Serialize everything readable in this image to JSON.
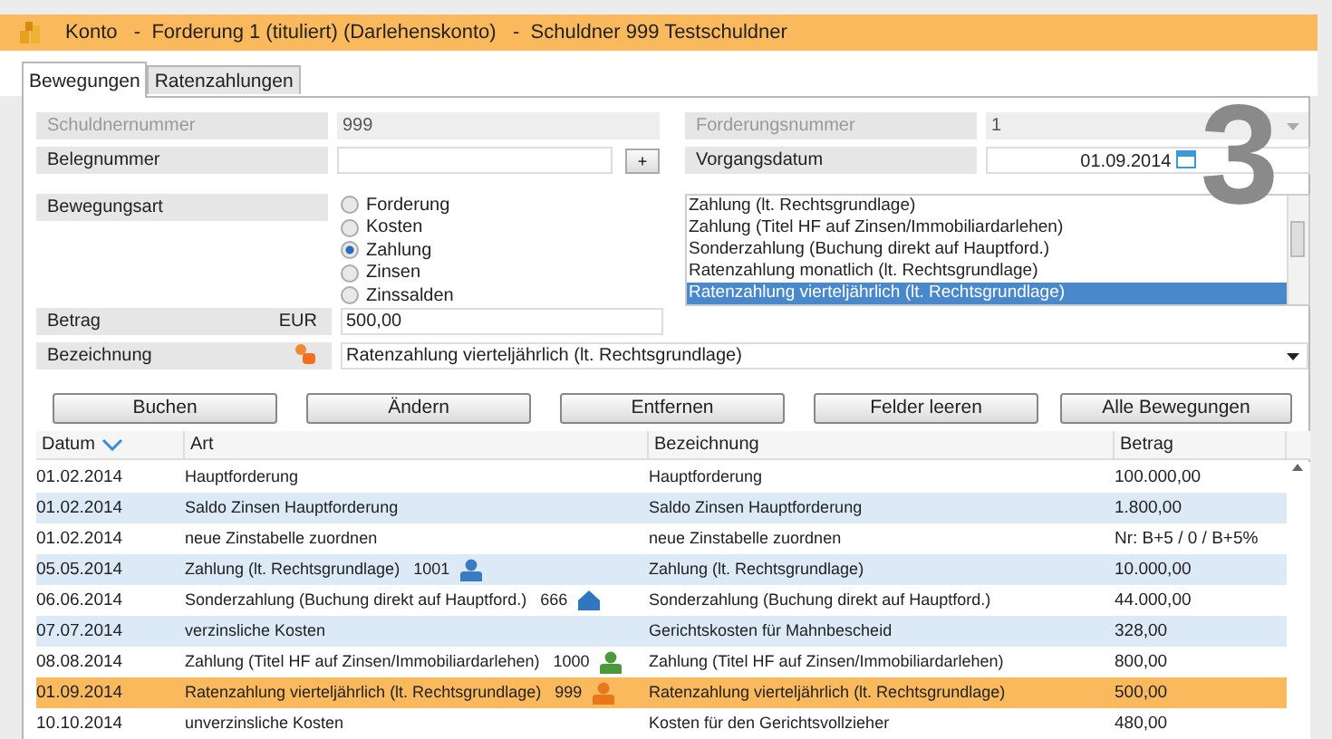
{
  "window": {
    "title": "Konto   -  Forderung 1 (tituliert) (Darlehenskonto)   -  Schuldner 999 Testschuldner"
  },
  "tabs": [
    {
      "label": "Bewegungen",
      "selected": true
    },
    {
      "label": "Ratenzahlungen",
      "selected": false
    }
  ],
  "form": {
    "schuldnernummer": {
      "label": "Schuldnernummer",
      "value": "999",
      "disabled": true
    },
    "forderungsnummer": {
      "label": "Forderungsnummer",
      "value": "1",
      "disabled": true
    },
    "belegnummer": {
      "label": "Belegnummer",
      "button": "+"
    },
    "vorgangsdatum": {
      "label": "Vorgangsdatum",
      "value": "01.09.2014"
    },
    "bewegungsart": {
      "label": "Bewegungsart",
      "options": [
        {
          "label": "Forderung",
          "selected": false
        },
        {
          "label": "Kosten",
          "selected": false
        },
        {
          "label": "Zahlung",
          "selected": true
        },
        {
          "label": "Zinsen",
          "selected": false
        },
        {
          "label": "Zinssalden",
          "selected": false
        }
      ]
    },
    "art_list": [
      {
        "label": "Zahlung (lt. Rechtsgrundlage)",
        "selected": false
      },
      {
        "label": "Zahlung (Titel HF auf Zinsen/Immobiliardarlehen)",
        "selected": false
      },
      {
        "label": "Sonderzahlung (Buchung direkt auf Hauptford.)",
        "selected": false
      },
      {
        "label": "Ratenzahlung monatlich (lt. Rechtsgrundlage)",
        "selected": false
      },
      {
        "label": "Ratenzahlung vierteljährlich (lt. Rechtsgrundlage)",
        "selected": true
      }
    ],
    "betrag": {
      "label": "Betrag",
      "currency": "EUR",
      "value": "500,00"
    },
    "bezeichnung": {
      "label": "Bezeichnung",
      "value": "Ratenzahlung vierteljährlich (lt. Rechtsgrundlage)"
    }
  },
  "step_marker": "3",
  "buttons": [
    "Buchen",
    "Ändern",
    "Entfernen",
    "Felder leeren",
    "Alle Bewegungen"
  ],
  "table": {
    "columns": [
      "Datum",
      "Art",
      "Bezeichnung",
      "Betrag"
    ],
    "rows": [
      {
        "datum": "01.02.2014",
        "art": "Hauptforderung",
        "bezeichnung": "Hauptforderung",
        "betrag": "100.000,00",
        "selected": false
      },
      {
        "datum": "01.02.2014",
        "art": "Saldo Zinsen Hauptforderung",
        "bezeichnung": "Saldo Zinsen Hauptforderung",
        "betrag": "1.800,00",
        "selected": false
      },
      {
        "datum": "01.02.2014",
        "art": "neue Zinstabelle zuordnen",
        "bezeichnung": "neue Zinstabelle zuordnen",
        "betrag": "Nr: B+5 / 0 / B+5%",
        "selected": false
      },
      {
        "datum": "05.05.2014",
        "art": "Zahlung (lt. Rechtsgrundlage)   1001",
        "icon": {
          "kind": "person",
          "color": "#3a7cc2"
        },
        "bezeichnung": "Zahlung (lt. Rechtsgrundlage)",
        "betrag": "10.000,00",
        "selected": false
      },
      {
        "datum": "06.06.2014",
        "art": "Sonderzahlung (Buchung direkt auf Hauptford.)   666",
        "icon": {
          "kind": "house",
          "color": "#2f78c0"
        },
        "bezeichnung": "Sonderzahlung (Buchung direkt auf Hauptford.)",
        "betrag": "44.000,00",
        "selected": false
      },
      {
        "datum": "07.07.2014",
        "art": "verzinsliche Kosten",
        "bezeichnung": "Gerichtskosten für Mahnbescheid",
        "betrag": "328,00",
        "selected": false
      },
      {
        "datum": "08.08.2014",
        "art": "Zahlung (Titel HF auf Zinsen/Immobiliardarlehen)   1000",
        "icon": {
          "kind": "person",
          "color": "#4a9a3a"
        },
        "bezeichnung": "Zahlung (Titel HF auf Zinsen/Immobiliardarlehen)",
        "betrag": "800,00",
        "selected": false
      },
      {
        "datum": "01.09.2014",
        "art": "Ratenzahlung vierteljährlich (lt. Rechtsgrundlage)   999",
        "icon": {
          "kind": "person",
          "color": "#e8761a"
        },
        "bezeichnung": "Ratenzahlung vierteljährlich (lt. Rechtsgrundlage)",
        "betrag": "500,00",
        "selected": true
      },
      {
        "datum": "10.10.2014",
        "art": "unverzinsliche Kosten",
        "bezeichnung": "Kosten für den Gerichtsvollzieher",
        "betrag": "480,00",
        "selected": false
      }
    ]
  }
}
